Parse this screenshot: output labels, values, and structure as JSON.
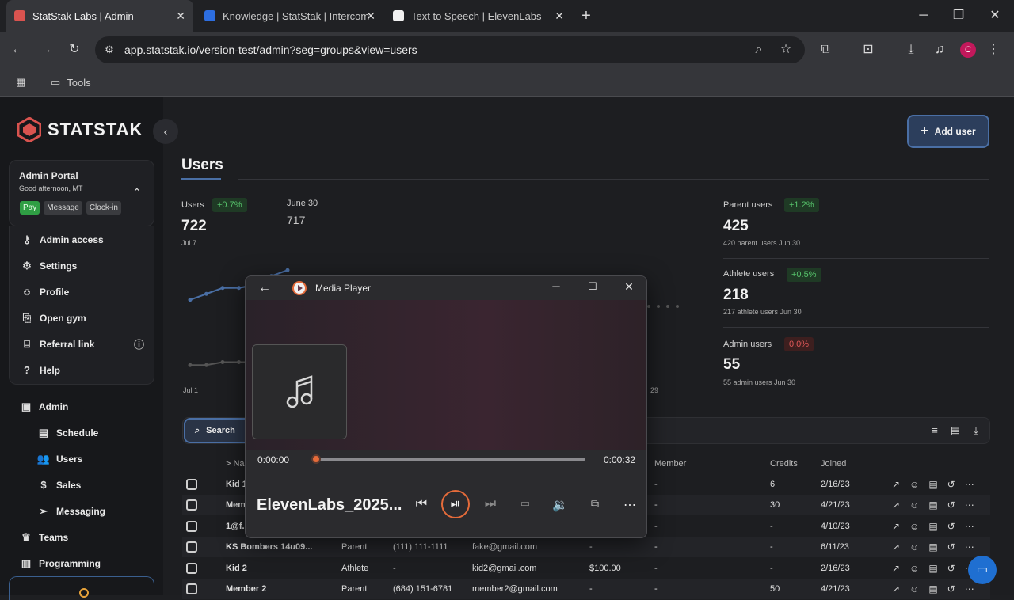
{
  "browser": {
    "tabs": [
      {
        "title": "StatStak Labs | Admin",
        "icon_color": "#d9534f"
      },
      {
        "title": "Knowledge | StatStak | Intercom",
        "icon_color": "#2d6ee0"
      },
      {
        "title": "Text to Speech | ElevenLabs",
        "icon_color": "#f1f1f1"
      }
    ],
    "url": "app.statstak.io/version-test/admin?seg=groups&view=users",
    "bookmark_folder": "Tools",
    "profile_initial": "C"
  },
  "sidebar": {
    "brand": "STATSTAK",
    "portal": {
      "title": "Admin Portal",
      "greeting": "Good afternoon, MT",
      "chips": [
        "Pay",
        "Message",
        "Clock-in"
      ]
    },
    "menu": [
      {
        "label": "Admin access",
        "icon": "key-icon"
      },
      {
        "label": "Settings",
        "icon": "gear-icon"
      },
      {
        "label": "Profile",
        "icon": "person-icon"
      },
      {
        "label": "Open gym",
        "icon": "door-icon"
      },
      {
        "label": "Referral link",
        "icon": "gift-icon"
      },
      {
        "label": "Help",
        "icon": "help-icon"
      }
    ],
    "admin": {
      "label": "Admin",
      "items": [
        {
          "label": "Schedule",
          "icon": "calendar-icon"
        },
        {
          "label": "Users",
          "icon": "users-icon"
        },
        {
          "label": "Sales",
          "icon": "dollar-icon"
        },
        {
          "label": "Messaging",
          "icon": "send-icon"
        }
      ]
    },
    "more": [
      {
        "label": "Teams",
        "icon": "trophy-icon"
      },
      {
        "label": "Programming",
        "icon": "notebook-icon"
      }
    ]
  },
  "main": {
    "add_user_label": "Add user",
    "page_title": "Users",
    "stats": {
      "users": {
        "label": "Users",
        "delta": "+0.7%",
        "value": "722",
        "date": "Jul 7"
      },
      "compare": {
        "label": "June 30",
        "value": "717"
      },
      "chart_start": "Jul 1",
      "chart_end": "29",
      "parent": {
        "label": "Parent users",
        "delta": "+1.2%",
        "value": "425",
        "sub": "420 parent users Jun 30"
      },
      "athlete": {
        "label": "Athlete users",
        "delta": "+0.5%",
        "value": "218",
        "sub": "217 athlete users Jun 30"
      },
      "admin": {
        "label": "Admin users",
        "delta": "0.0%",
        "value": "55",
        "sub": "55 admin users Jun 30"
      }
    },
    "search_label": "Search",
    "table": {
      "headers": {
        "name": "> Na",
        "member": "Member",
        "credits": "Credits",
        "joined": "Joined"
      },
      "rows": [
        {
          "name": "Kid 1",
          "role": "",
          "phone": "",
          "email": "",
          "amount": "",
          "member": "-",
          "credits": "6",
          "joined": "2/16/23"
        },
        {
          "name": "Mem",
          "role": "",
          "phone": "",
          "email": "",
          "amount": "",
          "member": "-",
          "credits": "30",
          "joined": "4/21/23"
        },
        {
          "name": "1@f.c",
          "role": "",
          "phone": "",
          "email": "",
          "amount": "",
          "member": "-",
          "credits": "-",
          "joined": "4/10/23"
        },
        {
          "name": "KS Bombers 14u09...",
          "role": "Parent",
          "phone": "(111) 111-1111",
          "email": "fake@gmail.com",
          "amount": "-",
          "member": "-",
          "credits": "-",
          "joined": "6/11/23"
        },
        {
          "name": "Kid 2",
          "role": "Athlete",
          "phone": "-",
          "email": "kid2@gmail.com",
          "amount": "$100.00",
          "member": "-",
          "credits": "-",
          "joined": "2/16/23"
        },
        {
          "name": "Member 2",
          "role": "Parent",
          "phone": "(684) 151-6781",
          "email": "member2@gmail.com",
          "amount": "-",
          "member": "-",
          "credits": "50",
          "joined": "4/21/23"
        }
      ]
    }
  },
  "media_player": {
    "title": "Media Player",
    "time_current": "0:00:00",
    "time_total": "0:00:32",
    "progress": 0,
    "track_name": "ElevenLabs_2025..."
  },
  "chart_data": {
    "type": "line",
    "x": [
      "Jul 1",
      "",
      "",
      "",
      "",
      "",
      ""
    ],
    "series": [
      {
        "values": [
          712,
          714,
          716,
          716,
          717,
          720,
          722
        ],
        "color": "#4a6fa5"
      },
      {
        "values": [
          690,
          690,
          691,
          691,
          691,
          691,
          691
        ],
        "color": "#555"
      }
    ]
  }
}
